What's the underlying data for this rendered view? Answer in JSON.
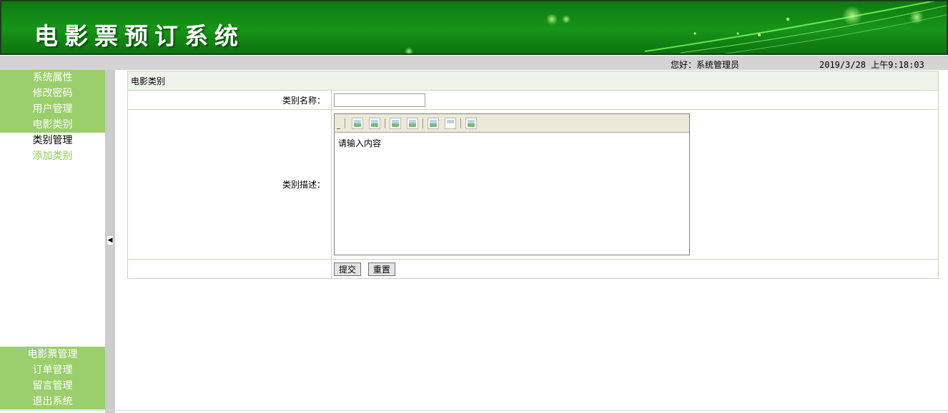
{
  "banner": {
    "title": "电影票预订系统"
  },
  "status": {
    "greeting": "您好：系统管理员",
    "datetime": "2019/3/28 上午9:18:03"
  },
  "sidebar": {
    "top_items": [
      {
        "label": "系统属性"
      },
      {
        "label": "修改密码"
      },
      {
        "label": "用户管理"
      },
      {
        "label": "电影类别"
      }
    ],
    "sub_items": [
      {
        "label": "类别管理",
        "state": "active"
      },
      {
        "label": "添加类别",
        "state": "normal"
      }
    ],
    "bottom_items": [
      {
        "label": "电影票管理"
      },
      {
        "label": "订单管理"
      },
      {
        "label": "留言管理"
      },
      {
        "label": "退出系统"
      }
    ]
  },
  "form": {
    "section_title": "电影类别",
    "name_label": "类别名称：",
    "name_value": "",
    "desc_label": "类别描述：",
    "desc_value": "请输入内容",
    "submit_label": "提交",
    "reset_label": "重置"
  },
  "colors": {
    "banner_green": "#138a13",
    "sidebar_green": "#9acf6b",
    "status_gray": "#d4d4d4",
    "form_border": "#c9d8b6"
  },
  "icons": [
    "collapse-arrow-icon",
    "toolbar-grip-icon",
    "image-icon"
  ]
}
